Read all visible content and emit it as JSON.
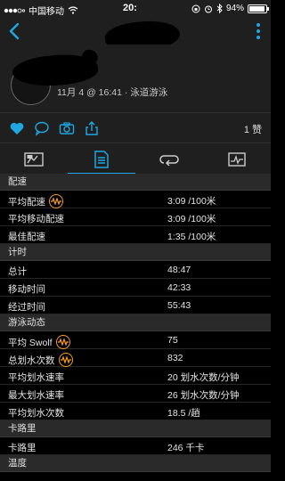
{
  "status_bar": {
    "carrier": "中国移动",
    "time": "20:",
    "battery": "94%",
    "battery_level": 0.94
  },
  "activity": {
    "meta": "11月 4 @ 16:41 · 泳道游泳",
    "likes": "1 赞"
  },
  "tabs": [
    {
      "name": "overview",
      "active": false
    },
    {
      "name": "stats",
      "active": true
    },
    {
      "name": "laps",
      "active": false
    },
    {
      "name": "charts",
      "active": false
    }
  ],
  "sections": {
    "pace": {
      "title": "配速",
      "rows": [
        {
          "label": "平均配速",
          "value": "3:09 /100米"
        },
        {
          "label": "平均移动配速",
          "value": "3:09 /100米"
        },
        {
          "label": "最佳配速",
          "value": "1:35 /100米"
        }
      ]
    },
    "timing": {
      "title": "计时",
      "rows": [
        {
          "label": "总计",
          "value": "48:47"
        },
        {
          "label": "移动时间",
          "value": "42:33"
        },
        {
          "label": "经过时间",
          "value": "55:43"
        }
      ]
    },
    "swim": {
      "title": "游泳动态",
      "rows": [
        {
          "label": "平均 Swolf",
          "value": "75"
        },
        {
          "label": "总划水次数",
          "value": "832"
        },
        {
          "label": "平均划水速率",
          "value": "20 划水次数/分钟"
        },
        {
          "label": "最大划水速率",
          "value": "26 划水次数/分钟"
        },
        {
          "label": "平均划水次数",
          "value": "18.5 /趟"
        }
      ]
    },
    "calories": {
      "title": "卡路里",
      "rows": [
        {
          "label": "卡路里",
          "value": "246 千卡"
        }
      ]
    },
    "temperature": {
      "title": "温度"
    }
  },
  "colors": {
    "accent": "#1ea7e1",
    "chart_icon": "#f59b1c",
    "bg": "#1f1f1f"
  }
}
